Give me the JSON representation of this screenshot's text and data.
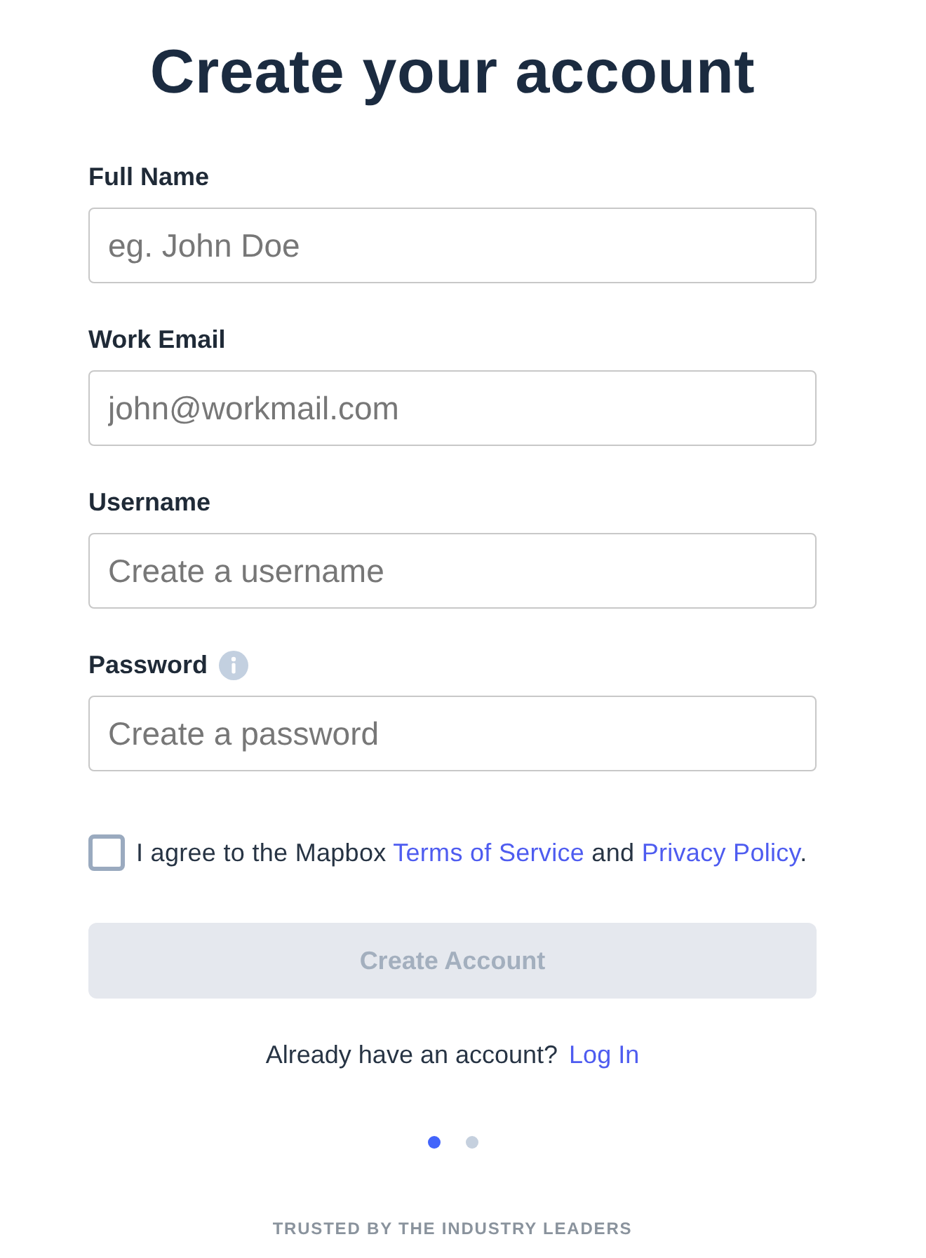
{
  "title": "Create your account",
  "fields": [
    {
      "label": "Full Name",
      "placeholder": "eg. John Doe",
      "info": false
    },
    {
      "label": "Work Email",
      "placeholder": "john@workmail.com",
      "info": false
    },
    {
      "label": "Username",
      "placeholder": "Create a username",
      "info": false
    },
    {
      "label": "Password",
      "placeholder": "Create a password",
      "info": true
    }
  ],
  "agreement": {
    "checked": false,
    "parts": [
      {
        "kind": "text",
        "text": "I agree to the Mapbox "
      },
      {
        "kind": "link",
        "text": "Terms of Service"
      },
      {
        "kind": "text",
        "text": " and "
      },
      {
        "kind": "link",
        "text": "Privacy Policy"
      },
      {
        "kind": "text",
        "text": "."
      }
    ]
  },
  "submit": {
    "label": "Create Account",
    "disabled": true
  },
  "login": {
    "text": "Already have an account?",
    "link": "Log In"
  },
  "pager": [
    {
      "selected": true
    },
    {
      "selected": false
    }
  ],
  "footer": "TRUSTED BY THE INDUSTRY LEADERS"
}
